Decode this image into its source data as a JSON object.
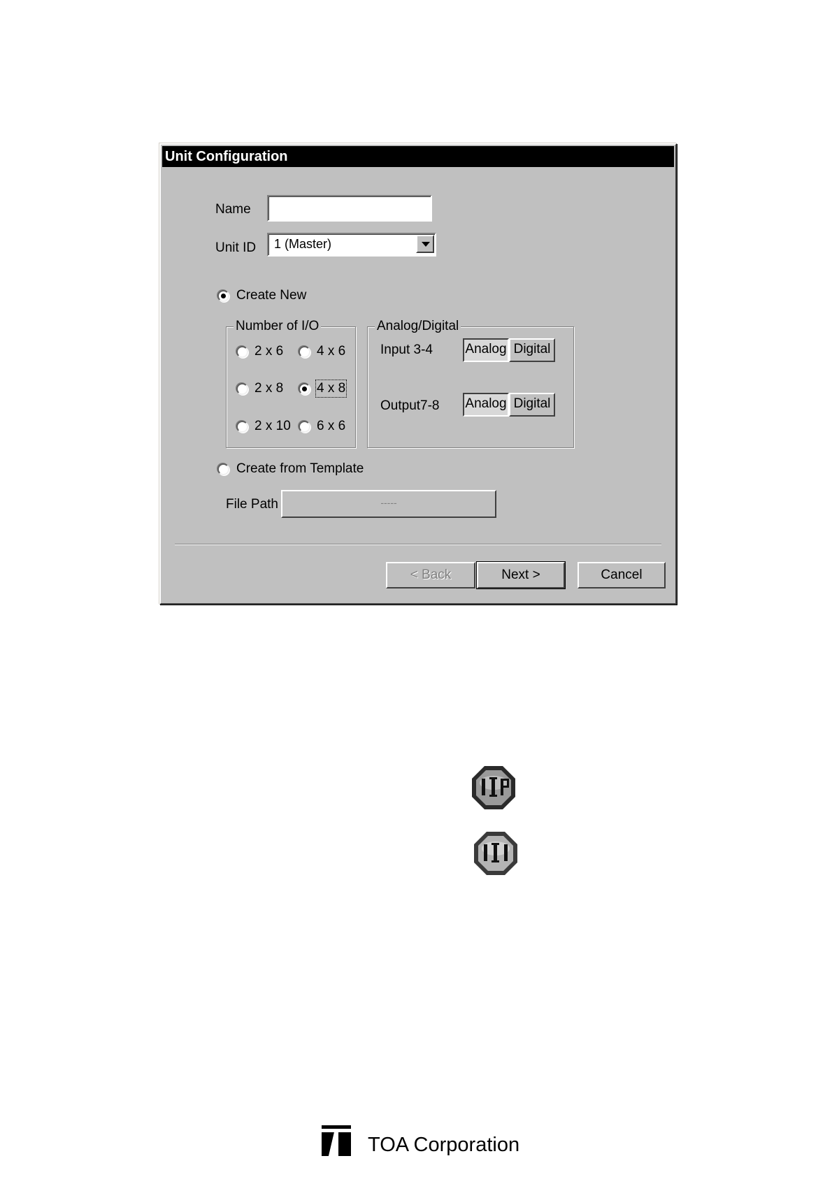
{
  "dialog": {
    "title": "Unit Configuration",
    "name_label": "Name",
    "name_value": "",
    "unit_id_label": "Unit ID",
    "unit_id_value": "1 (Master)",
    "create_new_label": "Create New",
    "io_group": {
      "title": "Number of I/O",
      "options": [
        "2 x 6",
        "4 x 6",
        "2 x 8",
        "4 x 8",
        "2 x 10",
        "6 x 6"
      ],
      "selected": "4 x 8"
    },
    "ad_group": {
      "title": "Analog/Digital",
      "input_label": "Input 3-4",
      "output_label": "Output7-8",
      "analog_label": "Analog",
      "digital_label": "Digital",
      "input_selected": "Analog",
      "output_selected": "Analog"
    },
    "template_label": "Create from Template",
    "filepath_label": "File Path",
    "filepath_value": "-----",
    "buttons": {
      "back": "< Back",
      "next": "Next >",
      "cancel": "Cancel"
    }
  },
  "icons": [
    "uip-icon-active",
    "ui-icon"
  ],
  "footer": {
    "company": "TOA Corporation"
  }
}
